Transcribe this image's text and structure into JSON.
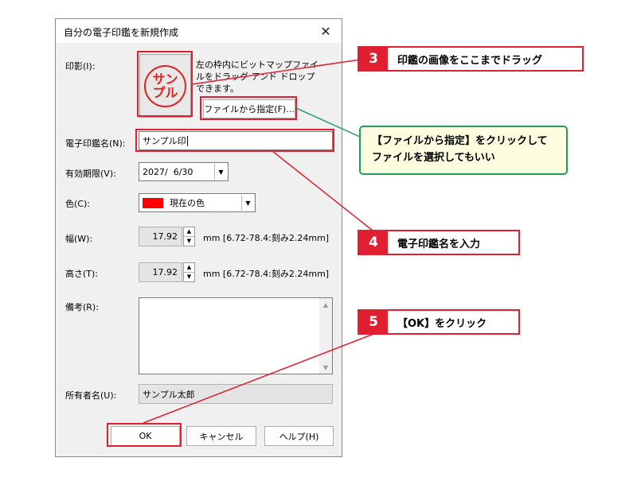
{
  "dialog": {
    "title": "自分の電子印鑑を新規作成",
    "labels": {
      "impression": "印影(I):",
      "stamp_name": "電子印鑑名(N):",
      "validity": "有効期限(V):",
      "color": "色(C):",
      "width": "幅(W):",
      "height": "高さ(T):",
      "remarks": "備考(R):",
      "owner": "所有者名(U):"
    },
    "stamp_text": [
      "サン",
      "プル"
    ],
    "hint": "左の枠内にビットマップファイルをドラッグ アンド ドロップできます。",
    "file_button": "ファイルから指定(F)...",
    "stamp_name_value": "サンプル印",
    "validity_value": "2027/  6/30",
    "color_value": "現在の色",
    "color_swatch": "#ff0000",
    "width_value": "17.92",
    "width_unit": "mm [6.72-78.4:刻み2.24mm]",
    "height_value": "17.92",
    "height_unit": "mm [6.72-78.4:刻み2.24mm]",
    "remarks_value": "",
    "owner_value": "サンプル太郎",
    "buttons": {
      "ok": "OK",
      "cancel": "キャンセル",
      "help": "ヘルプ(H)"
    }
  },
  "callouts": {
    "step3": {
      "num": "3",
      "text": "印鑑の画像をここまでドラッグ"
    },
    "note": {
      "line1": "【ファイルから指定】をクリックして",
      "line2": "ファイルを選択してもいい"
    },
    "step4": {
      "num": "4",
      "text": "電子印鑑名を入力"
    },
    "step5": {
      "num": "5",
      "text": "【OK】をクリック"
    }
  },
  "colors": {
    "accent_red": "#e02030",
    "note_green": "#239a5e"
  }
}
